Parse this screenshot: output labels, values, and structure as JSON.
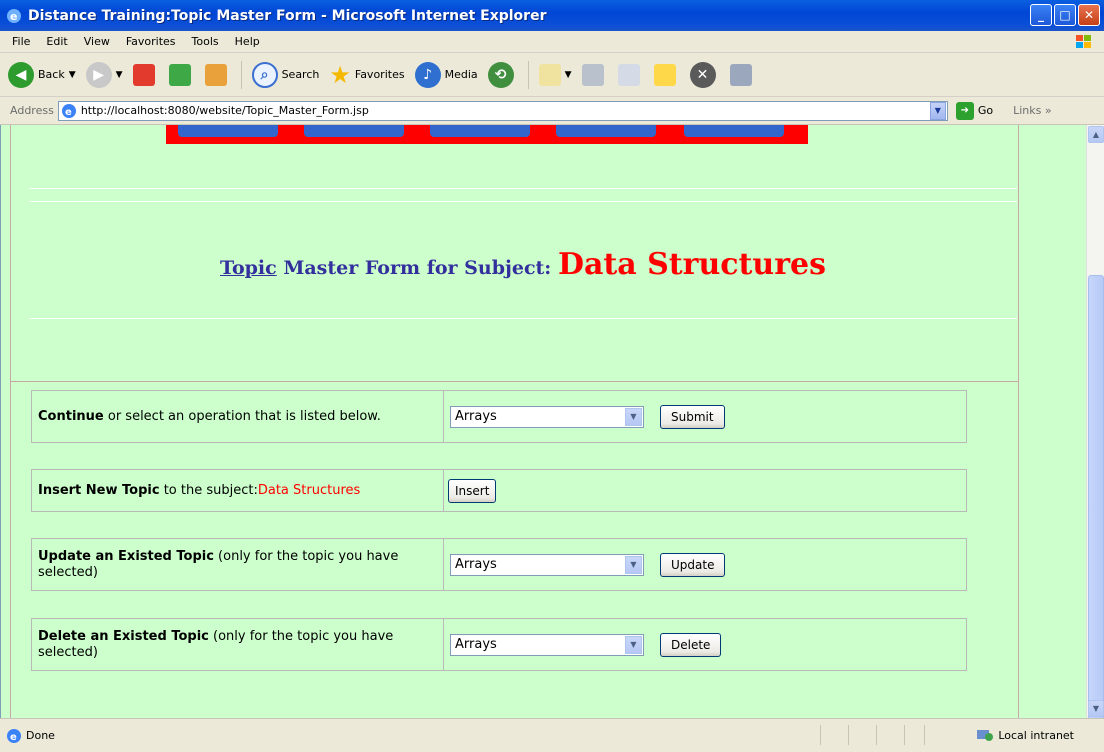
{
  "window": {
    "title": "Distance Training:Topic Master Form - Microsoft Internet Explorer"
  },
  "menu": [
    "File",
    "Edit",
    "View",
    "Favorites",
    "Tools",
    "Help"
  ],
  "toolbar": {
    "back": "Back",
    "search": "Search",
    "favorites": "Favorites",
    "media": "Media"
  },
  "address": {
    "label": "Address",
    "url": "http://localhost:8080/website/Topic_Master_Form.jsp",
    "go": "Go",
    "links": "Links"
  },
  "page": {
    "heading_link": "Topic",
    "heading_text": " Master Form for Subject: ",
    "subject": "Data Structures",
    "rows": {
      "continue": {
        "bold": "Continue",
        "rest": " or select an operation that is listed below.",
        "selected": "Arrays",
        "button": "Submit"
      },
      "insert": {
        "bold": "Insert New Topic",
        "rest": " to the subject:",
        "subject": "Data Structures",
        "button": "Insert"
      },
      "update": {
        "bold": "Update an Existed Topic",
        "rest": " (only for the topic you have selected)",
        "selected": "Arrays",
        "button": "Update"
      },
      "delete": {
        "bold": "Delete an Existed Topic",
        "rest": " (only for the topic you have selected)",
        "selected": "Arrays",
        "button": "Delete"
      }
    }
  },
  "status": {
    "text": "Done",
    "zone": "Local intranet"
  }
}
